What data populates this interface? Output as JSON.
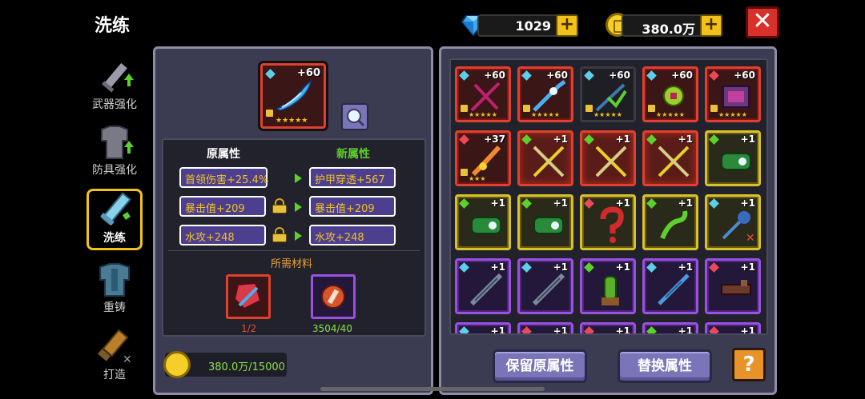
{
  "header": {
    "title": "洗练"
  },
  "currency": {
    "gems": "1029",
    "coins": "380.0万",
    "plus": "+",
    "close": "✕"
  },
  "nav": [
    {
      "label": "武器强化",
      "icon": "sword-upgrade-icon"
    },
    {
      "label": "防具强化",
      "icon": "armor-upgrade-icon"
    },
    {
      "label": "洗练",
      "icon": "refine-icon"
    },
    {
      "label": "重铸",
      "icon": "recast-icon"
    },
    {
      "label": "打造",
      "icon": "forge-icon"
    }
  ],
  "selected_item": {
    "level": "+60",
    "stars": "★★★★★"
  },
  "attributes": {
    "original_header": "原属性",
    "new_header": "新属性",
    "rows": [
      {
        "original": "首领伤害+25.4%",
        "new": "护甲穿透+567",
        "locked": false
      },
      {
        "original": "暴击值+209",
        "new": "暴击值+209",
        "locked": true
      },
      {
        "original": "水攻+248",
        "new": "水攻+248",
        "locked": true
      }
    ]
  },
  "materials": {
    "header": "所需材料",
    "items": [
      {
        "count": "1/2",
        "count_color": "#e84a3a"
      },
      {
        "count": "3504/40",
        "count_color": "#8ce04a"
      }
    ]
  },
  "cost": {
    "value": "380.0万/15000"
  },
  "grid": [
    {
      "level": "+60",
      "frame": "red",
      "stars": "★★★★★",
      "dot": "#5cd0e8"
    },
    {
      "level": "+60",
      "frame": "red",
      "stars": "★★★★★",
      "dot": "#5cd0e8"
    },
    {
      "level": "+60",
      "frame": "dark",
      "stars": "★★★★★",
      "dot": "#5cd0e8"
    },
    {
      "level": "+60",
      "frame": "red",
      "stars": "★★★★★",
      "dot": "#5cd0e8"
    },
    {
      "level": "+60",
      "frame": "red",
      "stars": "★★★★★",
      "dot": "#e84a5a"
    },
    {
      "level": "+37",
      "frame": "red",
      "stars": "★★★",
      "dot": "#e84a5a"
    },
    {
      "level": "+1",
      "frame": "redglow",
      "stars": "",
      "dot": "#5cd02c"
    },
    {
      "level": "+1",
      "frame": "redglow",
      "stars": "",
      "dot": "#5cd02c"
    },
    {
      "level": "+1",
      "frame": "redglow",
      "stars": "",
      "dot": "#5cd02c"
    },
    {
      "level": "+1",
      "frame": "gold",
      "stars": "",
      "dot": "#5cd02c"
    },
    {
      "level": "+1",
      "frame": "gold",
      "stars": "",
      "dot": "#5cd02c"
    },
    {
      "level": "+1",
      "frame": "gold",
      "stars": "",
      "dot": "#5cd02c"
    },
    {
      "level": "+1",
      "frame": "gold",
      "stars": "",
      "dot": "#e84a5a"
    },
    {
      "level": "+1",
      "frame": "gold",
      "stars": "",
      "dot": "#5cd02c"
    },
    {
      "level": "+1",
      "frame": "gold",
      "stars": "",
      "dot": "#5cd0e8"
    },
    {
      "level": "+1",
      "frame": "purple",
      "stars": "",
      "dot": "#5cd0e8"
    },
    {
      "level": "+1",
      "frame": "purple",
      "stars": "",
      "dot": "#5cd0e8"
    },
    {
      "level": "+1",
      "frame": "purple",
      "stars": "",
      "dot": "#5cd02c"
    },
    {
      "level": "+1",
      "frame": "purple",
      "stars": "",
      "dot": "#5cd0e8"
    },
    {
      "level": "+1",
      "frame": "purple",
      "stars": "",
      "dot": "#e84a5a"
    },
    {
      "level": "+1",
      "frame": "purple",
      "stars": "",
      "dot": "#5cd0e8"
    },
    {
      "level": "+1",
      "frame": "purple",
      "stars": "",
      "dot": "#e84a5a"
    },
    {
      "level": "+1",
      "frame": "purple",
      "stars": "",
      "dot": "#e84a5a"
    },
    {
      "level": "+1",
      "frame": "purple",
      "stars": "",
      "dot": "#5cd02c"
    },
    {
      "level": "+1",
      "frame": "purple",
      "stars": "",
      "dot": "#e84a5a"
    }
  ],
  "buttons": {
    "keep": "保留原属性",
    "replace": "替换属性",
    "help": "?"
  }
}
